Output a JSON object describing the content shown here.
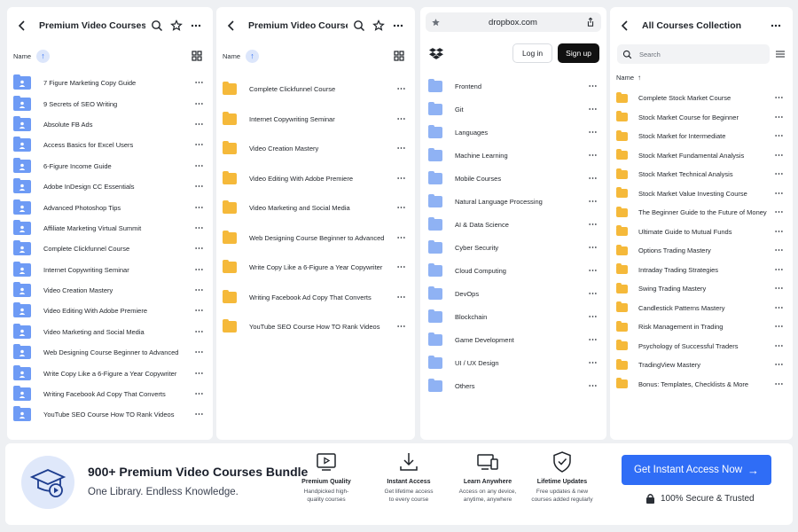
{
  "colors": {
    "accent": "#2f6df6",
    "folder_blue": "#6e9bf5",
    "folder_yellow": "#f5b93a"
  },
  "panel1": {
    "title": "Premium Video Courses",
    "name_header": "Name",
    "icons": [
      "back-icon",
      "search-icon",
      "star-icon",
      "more-icon",
      "grid-view-icon"
    ],
    "items": [
      "7 Figure Marketing Copy Guide",
      "9 Secrets of SEO Writing",
      "Absolute FB Ads",
      "Access Basics for Excel Users",
      "6-Figure Income Guide",
      "Adobe InDesign CC Essentials",
      "Advanced Photoshop Tips",
      "Affiliate Marketing Virtual Summit",
      "Complete Clickfunnel Course",
      "Internet Copywriting Seminar",
      "Video Creation Mastery",
      "Video Editing With Adobe Premiere",
      "Video Marketing and Social Media",
      "Web Designing Course Beginner to Advanced",
      "Write Copy Like a 6-Figure a Year Copywriter",
      "Writing Facebook Ad Copy That Converts",
      "YouTube SEO Course How TO Rank Videos"
    ]
  },
  "panel2": {
    "title": "Premium Video Courses",
    "name_header": "Name",
    "items": [
      "Complete Clickfunnel Course",
      "Internet Copywriting Seminar",
      "Video Creation Mastery",
      "Video Editing With Adobe Premiere",
      "Video Marketing and Social Media",
      "Web Designing Course Beginner to Advanced",
      "Write Copy Like a 6-Figure a Year Copywriter",
      "Writing Facebook Ad Copy That Converts",
      "YouTube SEO Course How TO Rank Videos"
    ]
  },
  "panel3": {
    "url": "dropbox.com",
    "login_label": "Log in",
    "signup_label": "Sign up",
    "items": [
      "Frontend",
      "Git",
      "Languages",
      "Machine Learning",
      "Mobile Courses",
      "Natural Language Processing",
      "AI & Data Science",
      "Cyber Security",
      "Cloud Computing",
      "DevOps",
      "Blockchain",
      "Game Development",
      "UI / UX Design",
      "Others"
    ]
  },
  "panel4": {
    "title": "All Courses Collection",
    "search_placeholder": "Search",
    "name_header": "Name",
    "items": [
      "Complete Stock Market Course",
      "Stock Market Course for Beginner",
      "Stock Market for Intermediate",
      "Stock Market Fundamental Analysis",
      "Stock Market Technical Analysis",
      "Stock Market Value Investing Course",
      "The Beginner Guide to the Future of Money",
      "Ultimate Guide to Mutual Funds",
      "Options Trading Mastery",
      "Intraday Trading Strategies",
      "Swing Trading Mastery",
      "Candlestick Patterns Mastery",
      "Risk Management in Trading",
      "Psychology of Successful Traders",
      "TradingView Mastery",
      "Bonus: Templates, Checklists & More"
    ]
  },
  "footer": {
    "title": "900+ Premium Video Courses Bundle",
    "subtitle": "One Library. Endless Knowledge.",
    "features": [
      {
        "icon": "play-screen-icon",
        "title": "Premium Quality",
        "desc1": "Handpicked high-",
        "desc2": "quality courses"
      },
      {
        "icon": "download-icon",
        "title": "Instant Access",
        "desc1": "Get lifetime access",
        "desc2": "to every course"
      },
      {
        "icon": "devices-icon",
        "title": "Learn Anywhere",
        "desc1": "Access on any device,",
        "desc2": "anytime, anywhere"
      },
      {
        "icon": "shield-check-icon",
        "title": "Lifetime Updates",
        "desc1": "Free updates & new",
        "desc2": "courses added regularly"
      }
    ],
    "cta_label": "Get Instant Access Now",
    "secure_label": "100% Secure & Trusted"
  }
}
